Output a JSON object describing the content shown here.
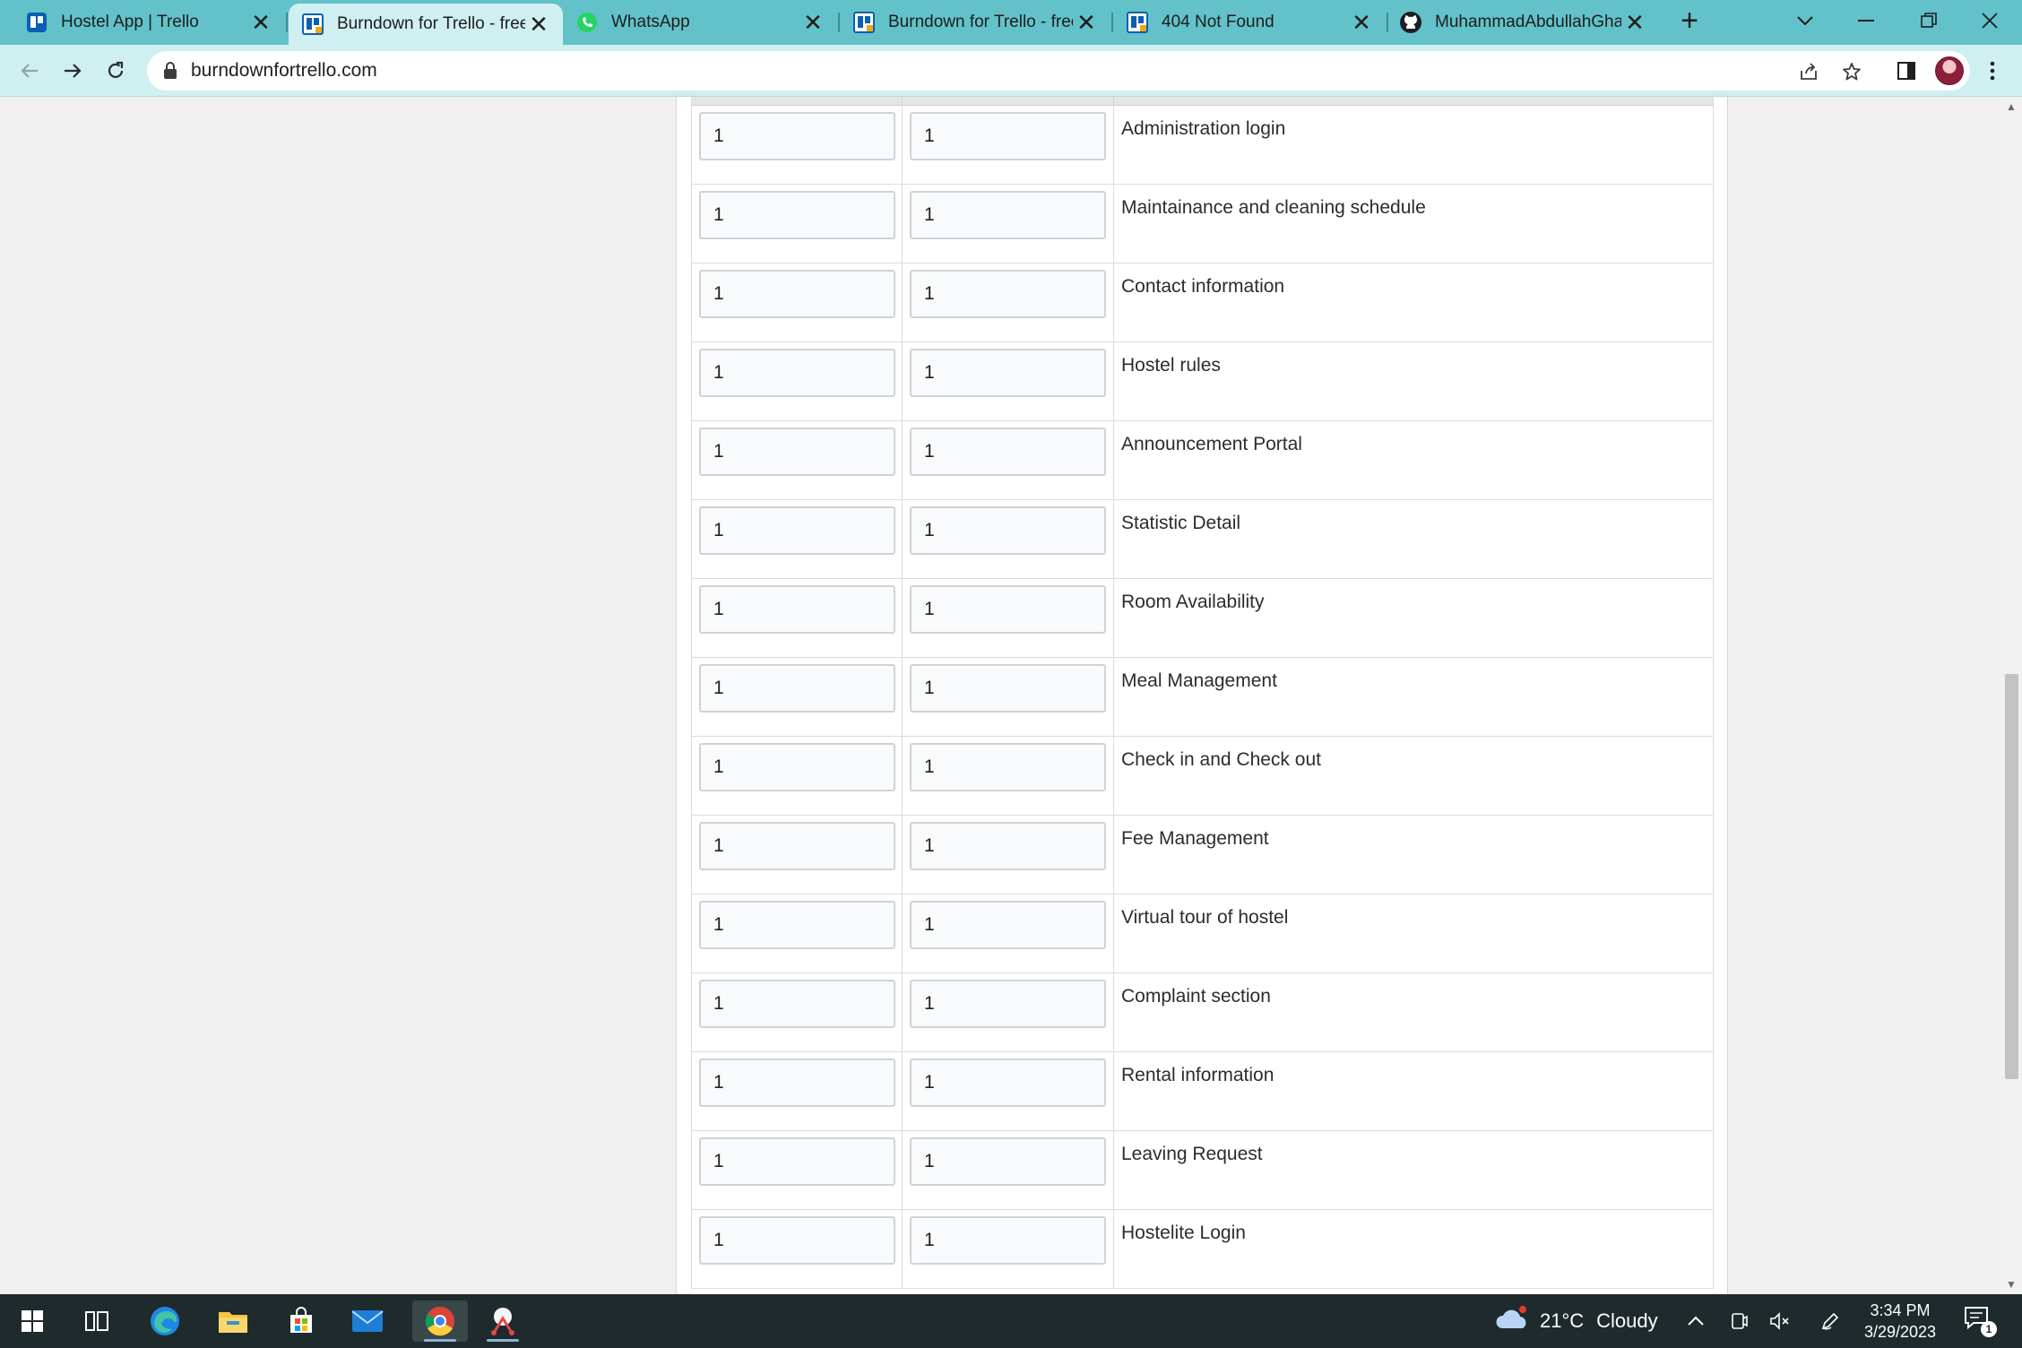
{
  "browser": {
    "tabs": [
      {
        "title": "Hostel App | Trello",
        "icon": "trello-icon",
        "active": false
      },
      {
        "title": "Burndown for Trello - free",
        "icon": "burndown-icon",
        "active": true
      },
      {
        "title": "WhatsApp",
        "icon": "whatsapp-icon",
        "active": false
      },
      {
        "title": "Burndown for Trello - free",
        "icon": "burndown-icon",
        "active": false
      },
      {
        "title": "404 Not Found",
        "icon": "burndown-icon",
        "active": false
      },
      {
        "title": "MuhammadAbdullahGhani",
        "icon": "github-icon",
        "active": false
      }
    ],
    "url": "burndownfortrello.com"
  },
  "tasks": [
    {
      "a": "1",
      "b": "1",
      "name": "Administration login"
    },
    {
      "a": "1",
      "b": "1",
      "name": "Maintainance and cleaning schedule"
    },
    {
      "a": "1",
      "b": "1",
      "name": "Contact information"
    },
    {
      "a": "1",
      "b": "1",
      "name": "Hostel rules"
    },
    {
      "a": "1",
      "b": "1",
      "name": "Announcement Portal"
    },
    {
      "a": "1",
      "b": "1",
      "name": "Statistic Detail"
    },
    {
      "a": "1",
      "b": "1",
      "name": "Room Availability"
    },
    {
      "a": "1",
      "b": "1",
      "name": "Meal Management"
    },
    {
      "a": "1",
      "b": "1",
      "name": "Check in and Check out"
    },
    {
      "a": "1",
      "b": "1",
      "name": "Fee Management"
    },
    {
      "a": "1",
      "b": "1",
      "name": "Virtual tour of hostel"
    },
    {
      "a": "1",
      "b": "1",
      "name": "Complaint section"
    },
    {
      "a": "1",
      "b": "1",
      "name": "Rental information"
    },
    {
      "a": "1",
      "b": "1",
      "name": "Leaving Request"
    },
    {
      "a": "1",
      "b": "1",
      "name": "Hostelite Login"
    }
  ],
  "taskbar": {
    "weather": {
      "temp": "21°C",
      "condition": "Cloudy"
    },
    "time": "3:34 PM",
    "date": "3/29/2023",
    "notification_count": "1"
  },
  "colors": {
    "tabstrip": "#63c2c9",
    "toolbar": "#cfeff1",
    "taskbar": "#1f2a2c"
  }
}
